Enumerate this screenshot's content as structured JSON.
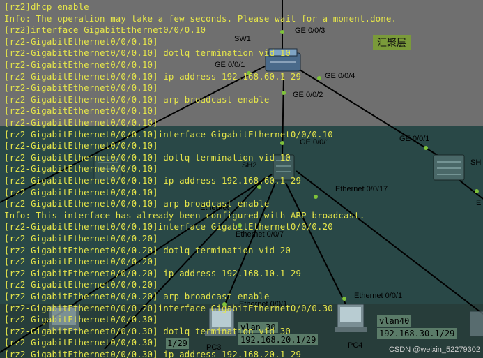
{
  "console": {
    "lines": [
      "[rz2]dhcp enable",
      "Info: The operation may take a few seconds. Please wait for a moment.done.",
      "[rz2]interface GigabitEthernet0/0/0.10",
      "[rz2-GigabitEthernet0/0/0.10]",
      "[rz2-GigabitEthernet0/0/0.10] dotlq termination vid 10",
      "[rz2-GigabitEthernet0/0/0.10]",
      "[rz2-GigabitEthernet0/0/0.10] ip address 192.168.60.1 29",
      "[rz2-GigabitEthernet0/0/0.10]",
      "[rz2-GigabitEthernet0/0/0.10] arp broadcast enable",
      "[rz2-GigabitEthernet0/0/0.10]",
      "[rz2-GigabitEthernet0/0/0.10]",
      "[rz2-GigabitEthernet0/0/0.10]interface GigabitEthernet0/0/0.10",
      "[rz2-GigabitEthernet0/0/0.10]",
      "[rz2-GigabitEthernet0/0/0.10] dotlq termination vid 10",
      "[rz2-GigabitEthernet0/0/0.10]",
      "[rz2-GigabitEthernet0/0/0.10] ip address 192.168.60.1 29",
      "[rz2-GigabitEthernet0/0/0.10]",
      "[rz2-GigabitEthernet0/0/0.10] arp broadcast enable",
      "Info: This interface has already been configured with ARP broadcast.",
      "[rz2-GigabitEthernet0/0/0.10]interface GigabitEthernet0/0/0.20",
      "[rz2-GigabitEthernet0/0/0.20]",
      "[rz2-GigabitEthernet0/0/0.20] dotlq termination vid 20",
      "[rz2-GigabitEthernet0/0/0.20]",
      "[rz2-GigabitEthernet0/0/0.20] ip address 192.168.10.1 29",
      "[rz2-GigabitEthernet0/0/0.20]",
      "[rz2-GigabitEthernet0/0/0.20] arp broadcast enable",
      "[rz2-GigabitEthernet0/0/0.20]interface GigabitEthernet0/0/0.30",
      "[rz2-GigabitEthernet0/0/0.30]",
      "[rz2-GigabitEthernet0/0/0.30] dotlq termination vid 30",
      "[rz2-GigabitEthernet0/0/0.30]",
      "[rz2-GigabitEthernet0/0/0.30] ip address 192.168.20.1 29"
    ]
  },
  "topology": {
    "layer_label": "汇聚层",
    "devices": {
      "sw1": "SW1",
      "sw2": "SH2",
      "sw3_partial": "SH",
      "pc3": "PC3",
      "pc4": "PC4"
    },
    "ports": {
      "sw1_top": "GE 0/0/3",
      "sw1_left": "GE 0/0/1",
      "sw1_right": "GE 0/0/4",
      "sw1_bottom": "GE 0/0/2",
      "sw2_top": "GE 0/0/1",
      "sw3_link": "GE 0/0/1",
      "sw2_eth17": "Ethernet 0/0/17",
      "sw2_eth_a": "Ethernet",
      "sw2_eth7": "Ethernet 0/0/7",
      "pc3_port": "Ethernet 0/0/1",
      "pc4_port": "Ethernet 0/0/1",
      "right_partial": "E"
    },
    "vlan_boxes": {
      "vlan30_name": "vlan 30",
      "vlan30_ip": "192.168.20.1/29",
      "vlan40_name": "vlan40",
      "vlan40_ip": "192.168.30.1/29",
      "left_ip_fragment": "1/29"
    }
  },
  "watermark": "CSDN @weixin_52279302",
  "colors": {
    "console_text": "#e6e64a",
    "top_panel": "#6f6f6f",
    "bottom_panel": "#294847",
    "vlan_box": "#5a7b68",
    "link_line": "#000000",
    "port_dot": "#7fc23a"
  }
}
